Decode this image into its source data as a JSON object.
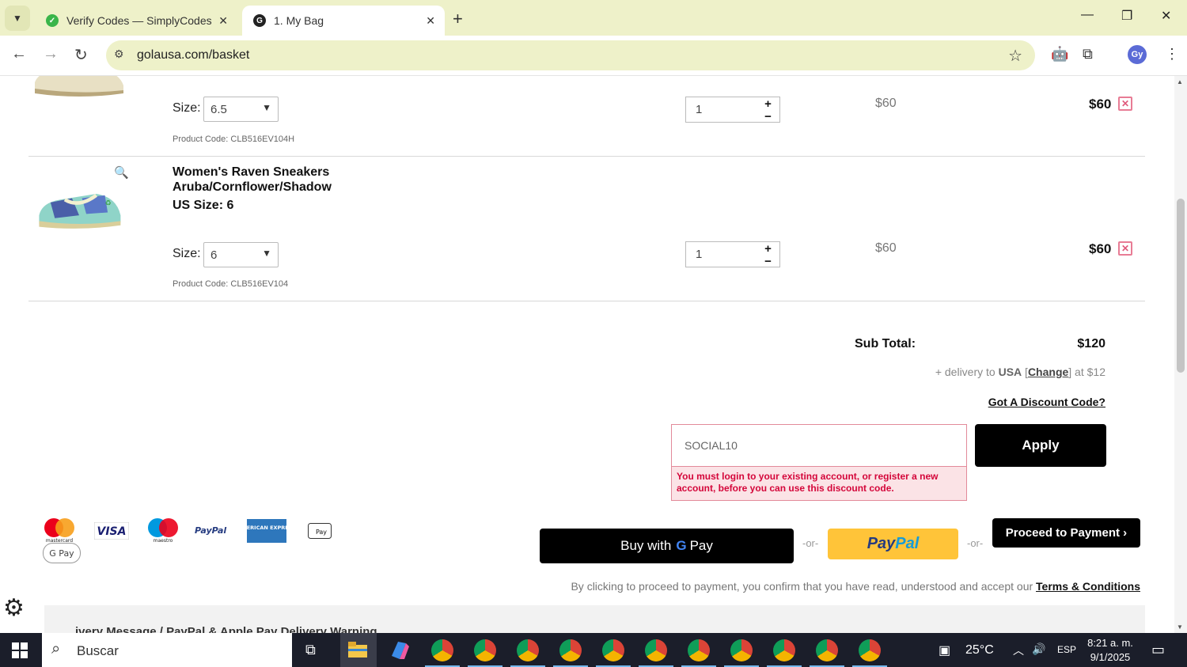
{
  "browser": {
    "tabs": [
      {
        "title": "Verify Codes — SimplyCodes",
        "active": false
      },
      {
        "title": "1. My Bag",
        "active": true
      }
    ],
    "url": "golausa.com/basket",
    "profile_initials": "Gy"
  },
  "cart": {
    "items": [
      {
        "size_label": "Size:",
        "size": "6.5",
        "product_code": "Product Code: CLB516EV104H",
        "quantity": "1",
        "unit_price": "$60",
        "total": "$60"
      },
      {
        "name_line1": "Women's Raven Sneakers",
        "name_line2": "Aruba/Cornflower/Shadow",
        "us_size": "US Size: 6",
        "size_label": "Size:",
        "size": "6",
        "product_code": "Product Code: CLB516EV104",
        "quantity": "1",
        "unit_price": "$60",
        "total": "$60"
      }
    ],
    "subtotal_label": "Sub Total:",
    "subtotal_value": "$120",
    "delivery_prefix": "+ delivery to ",
    "delivery_country": "USA",
    "delivery_change": "Change",
    "delivery_suffix": " at $12",
    "discount_link": "Got A Discount Code?",
    "discount_code_value": "SOCIAL10",
    "discount_error": "You must login to your existing account, or register a new account, before you can use this discount code.",
    "apply_label": "Apply"
  },
  "payment": {
    "logos": [
      "mastercard",
      "VISA",
      "maestro",
      "PayPal",
      "AMERICAN EXPRESS",
      "Pay",
      "G Pay"
    ],
    "gpay_label_pre": "Buy with",
    "gpay_label_g": "G",
    "gpay_label_post": "Pay",
    "or_label": "-or-",
    "paypal_pay": "Pay",
    "paypal_pal": "Pal",
    "proceed_label": "Proceed to Payment ›",
    "terms_text": "By clicking to proceed to payment, you confirm that you have read, understood and accept our ",
    "terms_link": "Terms & Conditions"
  },
  "banner_text": "…ivery Message / PayPal & Apple Pay Delivery Warning",
  "taskbar": {
    "search_placeholder": "Buscar",
    "weather": "25°C",
    "language": "ESP",
    "time": "8:21 a. m.",
    "date": "9/1/2025"
  },
  "colors": {
    "tab_bar": "#eef1c9",
    "error_red": "#d4063a",
    "paypal_yellow": "#ffc439",
    "remove_pink": "#e87c95"
  }
}
